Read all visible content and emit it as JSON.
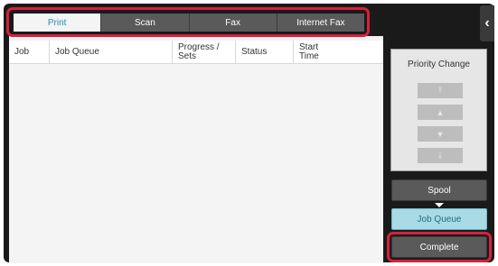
{
  "tabs": [
    {
      "label": "Print"
    },
    {
      "label": "Scan"
    },
    {
      "label": "Fax"
    },
    {
      "label": "Internet Fax"
    }
  ],
  "table": {
    "columns": [
      "Job",
      "Job Queue",
      "Progress / Sets",
      "Status",
      "Start Time"
    ]
  },
  "priority": {
    "title": "Priority Change",
    "buttons": [
      "top-icon",
      "up-icon",
      "down-icon",
      "bottom-icon"
    ]
  },
  "side_buttons": {
    "spool": "Spool",
    "job_queue": "Job Queue",
    "complete": "Complete"
  },
  "colors": {
    "highlight": "#d6213d",
    "active_tab_text": "#1f8fb8",
    "job_queue_bg": "#a8dbe5"
  }
}
